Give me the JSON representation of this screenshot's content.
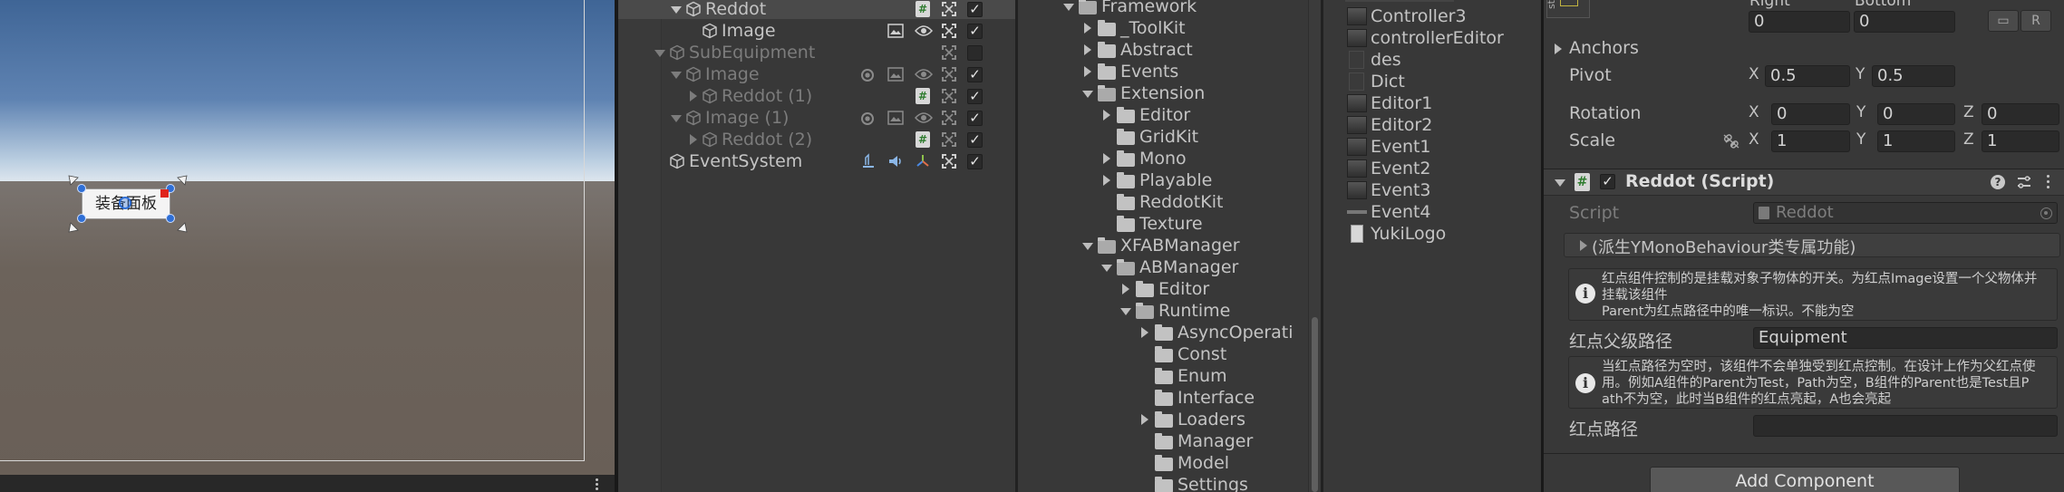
{
  "scene": {
    "button_label": "装备面板",
    "bottom_menu_icon": "kebab-icon"
  },
  "hierarchy": {
    "rows": [
      {
        "label": "Reddot",
        "indent": 3,
        "expanded": true,
        "active": true,
        "selected": true
      },
      {
        "label": "Image",
        "indent": 4,
        "active": true
      },
      {
        "label": "SubEquipment",
        "indent": 2,
        "expanded": true,
        "active": false
      },
      {
        "label": "Image",
        "indent": 3,
        "expanded": true,
        "active": false
      },
      {
        "label": "Reddot (1)",
        "indent": 4,
        "collapsed": true,
        "active": false
      },
      {
        "label": "Image (1)",
        "indent": 3,
        "expanded": true,
        "active": false
      },
      {
        "label": "Reddot (2)",
        "indent": 4,
        "collapsed": true,
        "active": false
      },
      {
        "label": "EventSystem",
        "indent": 2,
        "active": true
      }
    ]
  },
  "project_tree": {
    "items": [
      {
        "label": "Framework",
        "depth": 0,
        "state": "open"
      },
      {
        "label": "_ToolKit",
        "depth": 1,
        "state": "closed"
      },
      {
        "label": "Abstract",
        "depth": 1,
        "state": "closed"
      },
      {
        "label": "Events",
        "depth": 1,
        "state": "closed"
      },
      {
        "label": "Extension",
        "depth": 1,
        "state": "open"
      },
      {
        "label": "Editor",
        "depth": 2,
        "state": "closed"
      },
      {
        "label": "GridKit",
        "depth": 2,
        "state": "none"
      },
      {
        "label": "Mono",
        "depth": 2,
        "state": "closed"
      },
      {
        "label": "Playable",
        "depth": 2,
        "state": "closed"
      },
      {
        "label": "ReddotKit",
        "depth": 2,
        "state": "none"
      },
      {
        "label": "Texture",
        "depth": 2,
        "state": "none"
      },
      {
        "label": "XFABManager",
        "depth": 1,
        "state": "open"
      },
      {
        "label": "ABManager",
        "depth": 2,
        "state": "open"
      },
      {
        "label": "Editor",
        "depth": 3,
        "state": "closed"
      },
      {
        "label": "Runtime",
        "depth": 3,
        "state": "open"
      },
      {
        "label": "AsyncOperati",
        "depth": 4,
        "state": "closed"
      },
      {
        "label": "Const",
        "depth": 4,
        "state": "none"
      },
      {
        "label": "Enum",
        "depth": 4,
        "state": "none"
      },
      {
        "label": "Interface",
        "depth": 4,
        "state": "none"
      },
      {
        "label": "Loaders",
        "depth": 4,
        "state": "closed"
      },
      {
        "label": "Manager",
        "depth": 4,
        "state": "none"
      },
      {
        "label": "Model",
        "depth": 4,
        "state": "none"
      },
      {
        "label": "Settings",
        "depth": 4,
        "state": "none"
      }
    ]
  },
  "project_files": {
    "items": [
      "Controller3",
      "controllerEditor",
      "des",
      "Dict",
      "Editor1",
      "Editor2",
      "Event1",
      "Event2",
      "Event3",
      "Event4",
      "YukiLogo"
    ]
  },
  "inspector": {
    "rect": {
      "right_label": "Right",
      "bottom_label": "Bottom",
      "right_value": "0",
      "bottom_value": "0",
      "blueprint_btn": "▭",
      "raw_btn": "R"
    },
    "anchors_label": "Anchors",
    "pivot": {
      "label": "Pivot",
      "x_label": "X",
      "x": "0.5",
      "y_label": "Y",
      "y": "0.5"
    },
    "rotation": {
      "label": "Rotation",
      "x_label": "X",
      "x": "0",
      "y_label": "Y",
      "y": "0",
      "z_label": "Z",
      "z": "0"
    },
    "scale": {
      "label": "Scale",
      "x_label": "X",
      "x": "1",
      "y_label": "Y",
      "y": "1",
      "z_label": "Z",
      "z": "1"
    },
    "component": {
      "title": "Reddot (Script)",
      "script_label": "Script",
      "script_value": "Reddot",
      "foldout_label": "(派生YMonoBehaviour类专属功能)",
      "help1_line1": "红点组件控制的是挂载对象子物体的开关。为红点Image设置一个父物体并",
      "help1_line2": "挂载该组件",
      "help1_line3": "Parent为红点路径中的唯一标识。不能为空",
      "parent_path_label": "红点父级路径",
      "parent_path_value": "Equipment",
      "help2_line1": "当红点路径为空时，该组件不会单独受到红点控制。在设计上作为父红点使",
      "help2_line2": "用。例如A组件的Parent为Test，Path为空，B组件的Parent也是Test且P",
      "help2_line3": "ath不为空，此时当B组件的红点亮起，A也会亮起",
      "path_label": "红点路径",
      "path_value": ""
    },
    "add_component": "Add Component"
  },
  "colors": {
    "panel": "#383838",
    "selected_row": "#4d4d4d",
    "accent_blue": "#3a79d4",
    "sky_top": "#4a6c99",
    "ground": "#6a6058"
  }
}
